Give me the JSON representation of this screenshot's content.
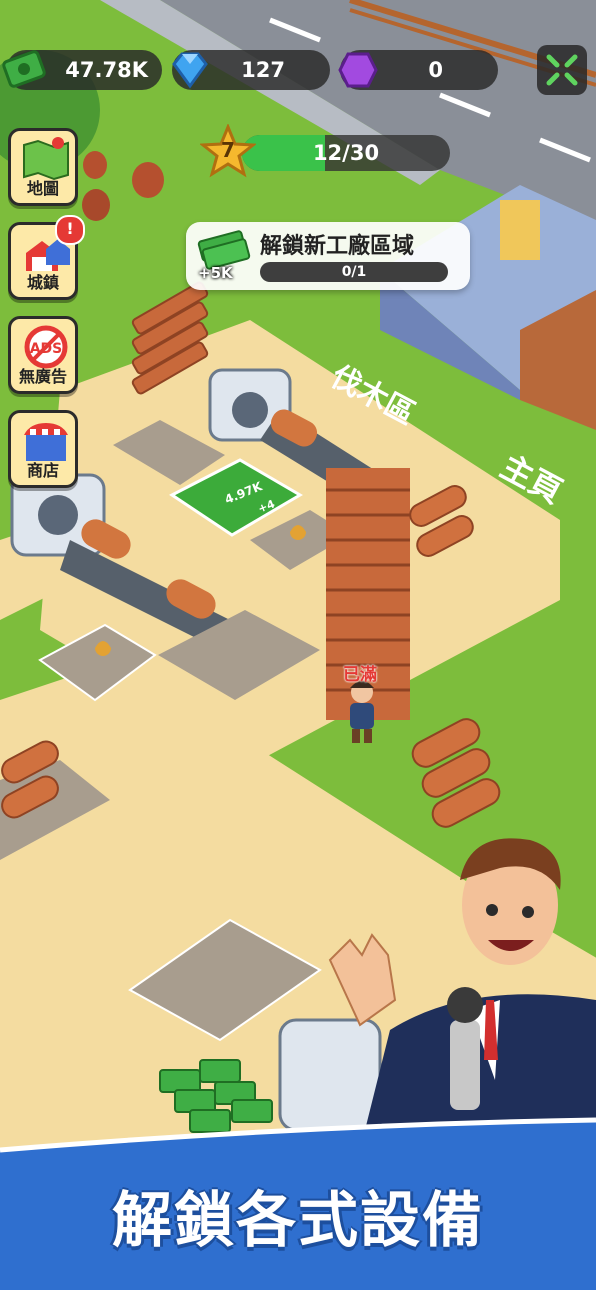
{
  "hud": {
    "cash": "47.78K",
    "gems": "127",
    "crystals": "0",
    "fullscreen_icon": "shrink-arrows-icon"
  },
  "level": {
    "number": "7",
    "progress_text": "12/30",
    "progress_fraction": 0.4
  },
  "quest": {
    "title": "解鎖新工廠區域",
    "progress_text": "0/1",
    "reward": "+5K"
  },
  "side_menu": [
    {
      "label": "地圖",
      "icon": "map-icon"
    },
    {
      "label": "城鎮",
      "icon": "town-icon",
      "alert": "!"
    },
    {
      "label": "無廣告",
      "icon": "no-ads-icon"
    },
    {
      "label": "商店",
      "icon": "shop-icon"
    }
  ],
  "world": {
    "zone_label_1": "伐木區",
    "zone_label_2": "主頁",
    "stack_full_label": "已滿",
    "tile_income": "4.97K",
    "tile_income_rate": "+4"
  },
  "banner": {
    "headline": "解鎖各式設備"
  },
  "colors": {
    "grass": "#7fbf3f",
    "sand": "#f4dca0",
    "banner_blue": "#2f6fcf",
    "level_green": "#3ac24a"
  }
}
